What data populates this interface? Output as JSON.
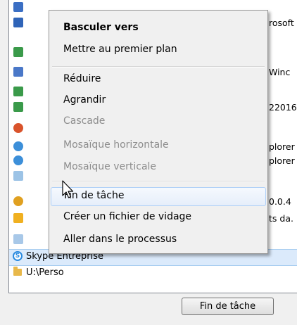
{
  "task_list": {
    "right_texts": [
      "rosoft",
      "Winc",
      "22016",
      "plorer",
      "plorer",
      "0.0.4",
      "ts da."
    ],
    "selected_item": "Skype Entreprise",
    "folder_item": "U:\\Perso"
  },
  "context_menu": {
    "items": [
      {
        "label": "Basculer vers",
        "style": "bold"
      },
      {
        "label": "Mettre au premier plan",
        "style": "normal"
      },
      {
        "label": "Réduire",
        "style": "normal"
      },
      {
        "label": "Agrandir",
        "style": "normal"
      },
      {
        "label": "Cascade",
        "style": "disabled"
      },
      {
        "label": "Mosaïque horizontale",
        "style": "disabled"
      },
      {
        "label": "Mosaïque verticale",
        "style": "disabled"
      },
      {
        "label": "Fin de tâche",
        "style": "hover"
      },
      {
        "label": "Créer un fichier de vidage",
        "style": "normal"
      },
      {
        "label": "Aller dans le processus",
        "style": "normal"
      }
    ]
  },
  "buttons": {
    "end_task": "Fin de tâche"
  },
  "colors": {
    "selection": "#dbeafb",
    "menu_hover_border": "#aecff7",
    "disabled_text": "#8d8d8d"
  }
}
